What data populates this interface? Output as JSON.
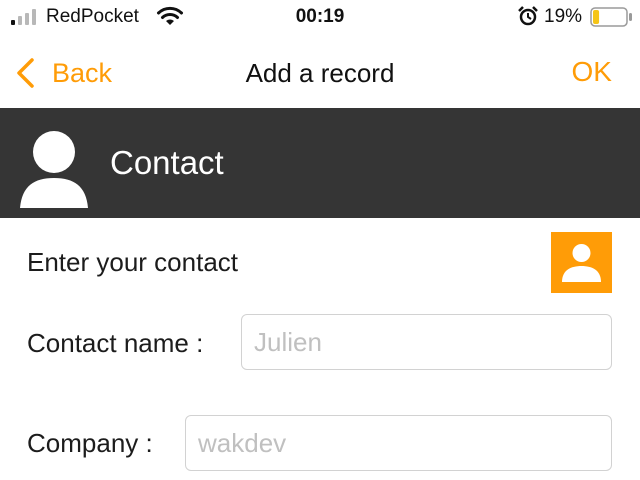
{
  "status_bar": {
    "carrier": "RedPocket",
    "time": "00:19",
    "battery": "19%",
    "battery_level": 0.19,
    "icons": [
      "signal-icon",
      "wifi-icon",
      "alarm-icon",
      "battery-icon"
    ]
  },
  "nav": {
    "back_label": "Back",
    "title": "Add a record",
    "ok_label": "OK"
  },
  "section": {
    "title": "Contact",
    "icon": "person-icon"
  },
  "form": {
    "prompt": "Enter your contact",
    "contact_button_icon": "contact-card-icon",
    "fields": [
      {
        "label": "Contact name :",
        "value": "",
        "placeholder": "Julien"
      },
      {
        "label": "Company :",
        "value": "",
        "placeholder": "wakdev"
      }
    ]
  },
  "colors": {
    "accent": "#ff9c07",
    "header_bg": "#353535",
    "placeholder": "#c0c0c0",
    "border": "#d2d2d2"
  }
}
